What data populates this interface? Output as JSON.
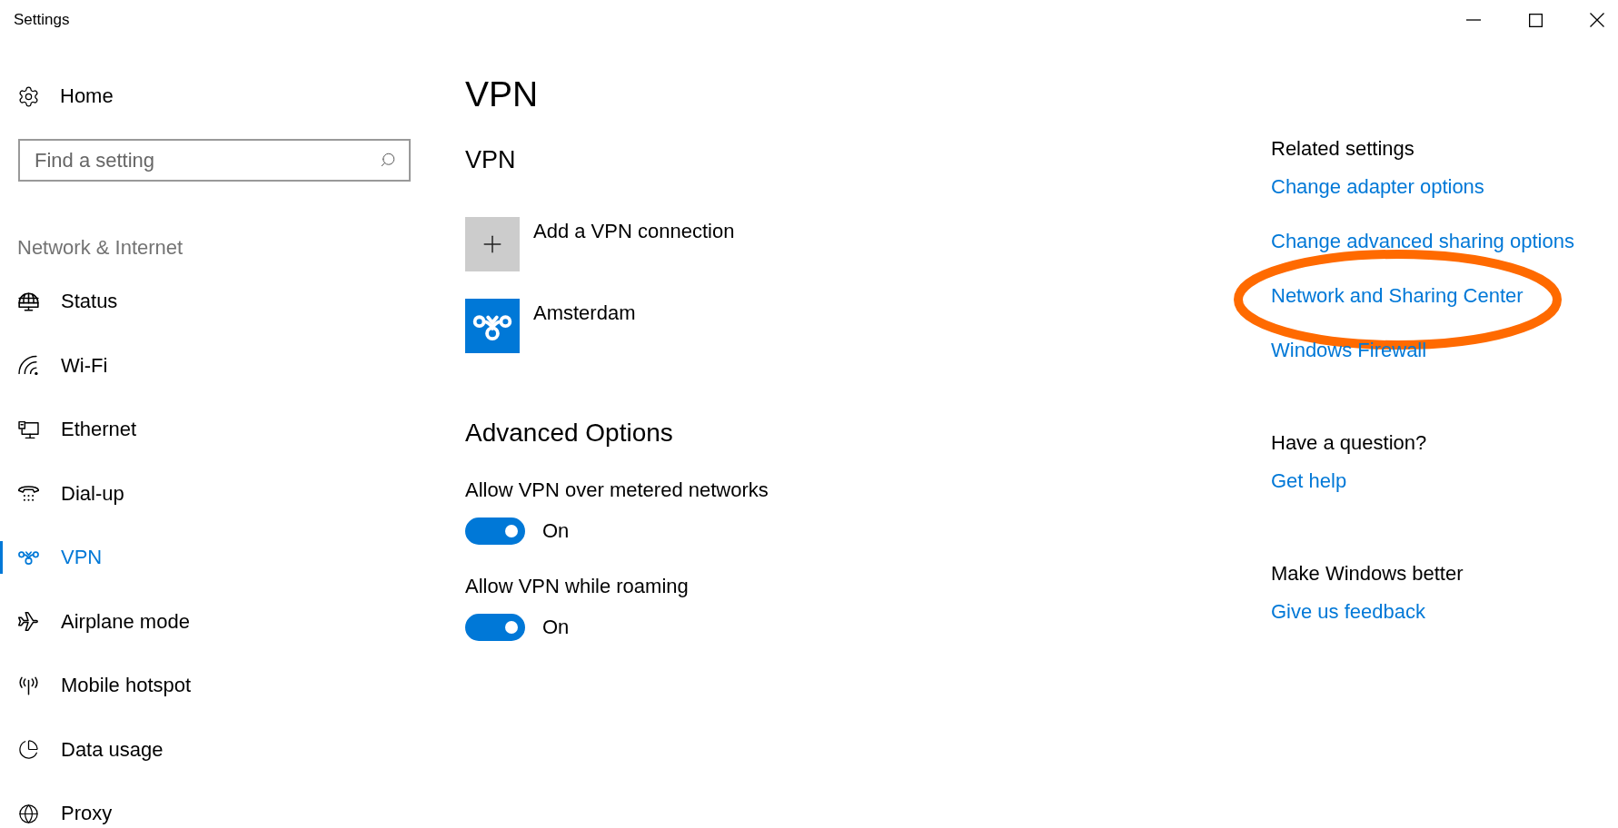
{
  "window": {
    "title": "Settings"
  },
  "sidebar": {
    "home": "Home",
    "search": {
      "placeholder": "Find a setting"
    },
    "section": "Network & Internet",
    "items": [
      {
        "label": "Status",
        "selected": false
      },
      {
        "label": "Wi-Fi",
        "selected": false
      },
      {
        "label": "Ethernet",
        "selected": false
      },
      {
        "label": "Dial-up",
        "selected": false
      },
      {
        "label": "VPN",
        "selected": true
      },
      {
        "label": "Airplane mode",
        "selected": false
      },
      {
        "label": "Mobile hotspot",
        "selected": false
      },
      {
        "label": "Data usage",
        "selected": false
      },
      {
        "label": "Proxy",
        "selected": false
      }
    ]
  },
  "page": {
    "title": "VPN",
    "vpn": {
      "heading": "VPN",
      "connections": [
        {
          "kind": "add",
          "label": "Add a VPN connection"
        },
        {
          "kind": "vpn",
          "label": "Amsterdam"
        }
      ]
    },
    "advanced": {
      "heading": "Advanced Options",
      "options": [
        {
          "label": "Allow VPN over metered networks",
          "on": true,
          "state": "On"
        },
        {
          "label": "Allow VPN while roaming",
          "on": true,
          "state": "On"
        }
      ]
    }
  },
  "related": [
    {
      "heading": "Related settings",
      "links": [
        {
          "label": "Change adapter options",
          "circled": false
        },
        {
          "label": "Change advanced sharing options",
          "circled": false
        },
        {
          "label": "Network and Sharing Center",
          "circled": true
        },
        {
          "label": "Windows Firewall",
          "circled": false
        }
      ]
    },
    {
      "heading": "Have a question?",
      "links": [
        {
          "label": "Get help",
          "circled": false
        }
      ]
    },
    {
      "heading": "Make Windows better",
      "links": [
        {
          "label": "Give us feedback",
          "circled": false
        }
      ]
    }
  ]
}
